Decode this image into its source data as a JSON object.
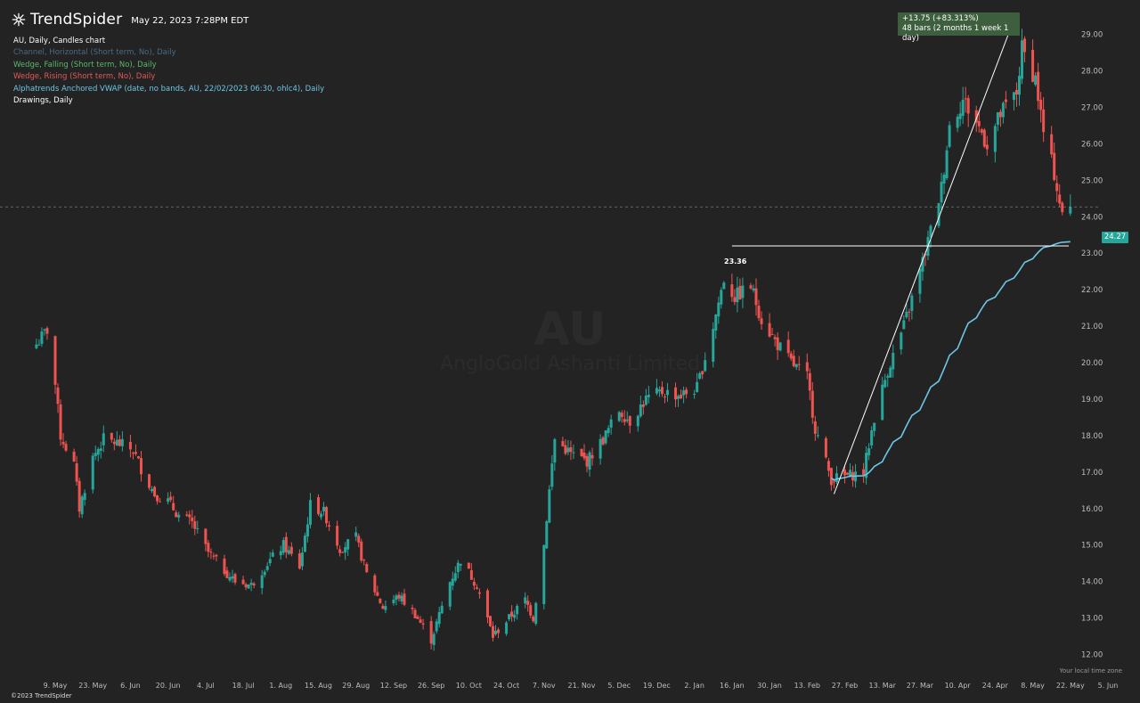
{
  "header": {
    "brand": "TrendSpider",
    "timestamp": "May 22, 2023 7:28PM EDT"
  },
  "legend": {
    "title": "AU, Daily, Candles chart",
    "channel": "Channel, Horizontal (Short term, No), Daily",
    "wedge_falling": "Wedge, Falling (Short term, No), Daily",
    "wedge_rising": "Wedge, Rising (Short term, No), Daily",
    "vwap": "Alphatrends Anchored VWAP (date, no bands, AU, 22/02/2023 06:30, ohlc4), Daily",
    "drawings": "Drawings, Daily"
  },
  "watermark": {
    "symbol": "AU",
    "name": "AngloGold Ashanti Limited"
  },
  "measure": {
    "line1": "+13.75 (+83.313%)",
    "line2": "48 bars (2 months 1 week 1 day)"
  },
  "price_tag": "24.27",
  "level_label": "23.36",
  "footer": {
    "copyright": "©2023 TrendSpider",
    "timezone_note": "Your local time zone"
  },
  "colors": {
    "background": "#232323",
    "up": "#26a69a",
    "down": "#ef5350",
    "vwap": "#6cc6e8",
    "measure_box": "#3e5f3e"
  },
  "chart_data": {
    "type": "candlestick",
    "ylim": [
      11.5,
      29.6
    ],
    "yticks": [
      12,
      13,
      14,
      15,
      16,
      17,
      18,
      19,
      20,
      21,
      22,
      23,
      24,
      25,
      26,
      27,
      28,
      29
    ],
    "ytick_labels": [
      "12.00",
      "13.00",
      "14.00",
      "15.00",
      "16.00",
      "17.00",
      "18.00",
      "19.00",
      "20.00",
      "21.00",
      "22.00",
      "23.00",
      "24.00",
      "25.00",
      "26.00",
      "27.00",
      "28.00",
      "29.00"
    ],
    "x_date_range": [
      "2023-05-01",
      "2023-05-30"
    ],
    "x_date_range_note_removed": true,
    "xtick_labels": [
      "9. May",
      "23. May",
      "6. Jun",
      "20. Jun",
      "4. Jul",
      "18. Jul",
      "1. Aug",
      "15. Aug",
      "29. Aug",
      "12. Sep",
      "26. Sep",
      "10. Oct",
      "24. Oct",
      "7. Nov",
      "21. Nov",
      "5. Dec",
      "19. Dec",
      "2. Jan",
      "16. Jan",
      "30. Jan",
      "13. Feb",
      "27. Feb",
      "13. Mar",
      "27. Mar",
      "10. Apr",
      "24. Apr",
      "8. May",
      "22. May",
      "5. Jun"
    ],
    "xtick_dates": [
      "2022-05-09",
      "2022-05-23",
      "2022-06-06",
      "2022-06-20",
      "2022-07-04",
      "2022-07-18",
      "2022-08-01",
      "2022-08-15",
      "2022-08-29",
      "2022-09-12",
      "2022-09-26",
      "2022-10-10",
      "2022-10-24",
      "2022-11-07",
      "2022-11-21",
      "2022-12-05",
      "2022-12-19",
      "2023-01-02",
      "2023-01-16",
      "2023-01-30",
      "2023-02-13",
      "2023-02-27",
      "2023-03-13",
      "2023-03-27",
      "2023-04-10",
      "2023-04-24",
      "2023-05-08",
      "2023-05-22",
      "2023-06-05"
    ],
    "close_path": [
      [
        "2022-05-02",
        20.5
      ],
      [
        "2022-05-06",
        20.9
      ],
      [
        "2022-05-09",
        19.4
      ],
      [
        "2022-05-11",
        18.0
      ],
      [
        "2022-05-16",
        17.2
      ],
      [
        "2022-05-18",
        16.0
      ],
      [
        "2022-05-23",
        17.4
      ],
      [
        "2022-05-27",
        17.9
      ],
      [
        "2022-06-01",
        17.8
      ],
      [
        "2022-06-07",
        17.6
      ],
      [
        "2022-06-10",
        17.1
      ],
      [
        "2022-06-15",
        16.4
      ],
      [
        "2022-06-20",
        16.2
      ],
      [
        "2022-06-24",
        15.8
      ],
      [
        "2022-06-29",
        15.6
      ],
      [
        "2022-07-05",
        14.8
      ],
      [
        "2022-07-11",
        14.3
      ],
      [
        "2022-07-15",
        14.0
      ],
      [
        "2022-07-21",
        13.9
      ],
      [
        "2022-07-27",
        14.5
      ],
      [
        "2022-08-02",
        15.0
      ],
      [
        "2022-08-08",
        14.4
      ],
      [
        "2022-08-12",
        16.1
      ],
      [
        "2022-08-17",
        15.9
      ],
      [
        "2022-08-23",
        14.9
      ],
      [
        "2022-08-29",
        15.2
      ],
      [
        "2022-09-02",
        14.2
      ],
      [
        "2022-09-08",
        13.3
      ],
      [
        "2022-09-14",
        13.6
      ],
      [
        "2022-09-20",
        13.1
      ],
      [
        "2022-09-26",
        12.4
      ],
      [
        "2022-10-03",
        14.0
      ],
      [
        "2022-10-07",
        14.6
      ],
      [
        "2022-10-13",
        13.9
      ],
      [
        "2022-10-19",
        12.5
      ],
      [
        "2022-10-25",
        13.0
      ],
      [
        "2022-10-31",
        13.5
      ],
      [
        "2022-11-03",
        13.0
      ],
      [
        "2022-11-07",
        15.0
      ],
      [
        "2022-11-09",
        16.5
      ],
      [
        "2022-11-11",
        17.9
      ],
      [
        "2022-11-17",
        17.5
      ],
      [
        "2022-11-23",
        17.3
      ],
      [
        "2022-11-29",
        17.9
      ],
      [
        "2022-12-05",
        18.7
      ],
      [
        "2022-12-09",
        18.4
      ],
      [
        "2022-12-15",
        19.0
      ],
      [
        "2022-12-21",
        19.2
      ],
      [
        "2022-12-28",
        19.1
      ],
      [
        "2023-01-03",
        19.3
      ],
      [
        "2023-01-09",
        21.0
      ],
      [
        "2023-01-13",
        22.3
      ],
      [
        "2023-01-17",
        21.8
      ],
      [
        "2023-01-23",
        22.1
      ],
      [
        "2023-01-27",
        21.2
      ],
      [
        "2023-02-01",
        20.6
      ],
      [
        "2023-02-07",
        20.0
      ],
      [
        "2023-02-13",
        19.6
      ],
      [
        "2023-02-16",
        18.2
      ],
      [
        "2023-02-22",
        16.8
      ],
      [
        "2023-02-28",
        16.9
      ],
      [
        "2023-03-06",
        17.0
      ],
      [
        "2023-03-10",
        18.5
      ],
      [
        "2023-03-15",
        19.8
      ],
      [
        "2023-03-21",
        21.0
      ],
      [
        "2023-03-27",
        22.5
      ],
      [
        "2023-03-31",
        23.6
      ],
      [
        "2023-04-04",
        24.8
      ],
      [
        "2023-04-07",
        26.5
      ],
      [
        "2023-04-12",
        27.2
      ],
      [
        "2023-04-17",
        26.6
      ],
      [
        "2023-04-21",
        26.0
      ],
      [
        "2023-04-26",
        26.8
      ],
      [
        "2023-05-02",
        27.4
      ],
      [
        "2023-05-04",
        28.6
      ],
      [
        "2023-05-09",
        27.8
      ],
      [
        "2023-05-12",
        26.3
      ],
      [
        "2023-05-16",
        25.2
      ],
      [
        "2023-05-19",
        24.0
      ],
      [
        "2023-05-22",
        24.27
      ]
    ],
    "vwap_anchor": "2023-02-22",
    "horizontal_level": 23.2,
    "horizontal_level_start": "2023-01-16",
    "measure_line": {
      "from": [
        "2023-02-23",
        16.4
      ],
      "to": [
        "2023-05-02",
        29.6
      ]
    },
    "last_price": 24.27
  }
}
